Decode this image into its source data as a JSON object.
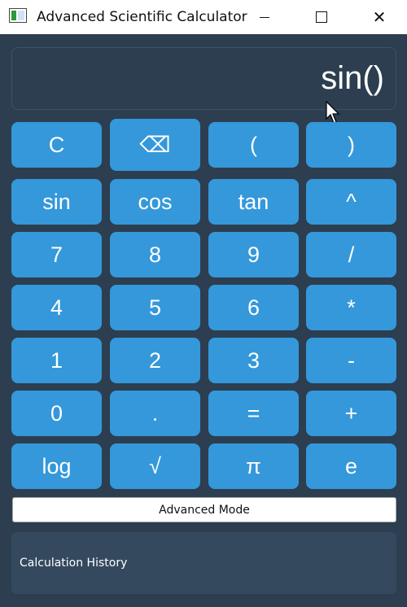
{
  "window": {
    "title": "Advanced Scientific Calculator",
    "controls": {
      "minimize": "—",
      "maximize": "",
      "close": "✕"
    }
  },
  "display": {
    "value": "sin()"
  },
  "keys": [
    [
      "C",
      "⌫",
      "(",
      ")"
    ],
    [
      "sin",
      "cos",
      "tan",
      "^"
    ],
    [
      "7",
      "8",
      "9",
      "/"
    ],
    [
      "4",
      "5",
      "6",
      "*"
    ],
    [
      "1",
      "2",
      "3",
      "-"
    ],
    [
      "0",
      ".",
      "=",
      "+"
    ],
    [
      "log",
      "√",
      "π",
      "e"
    ]
  ],
  "mode_button": {
    "label": "Advanced Mode"
  },
  "history": {
    "label": "Calculation History"
  },
  "colors": {
    "background": "#2c3e50",
    "key": "#3498db",
    "key_text": "#ffffff",
    "history_panel": "#34495e"
  }
}
